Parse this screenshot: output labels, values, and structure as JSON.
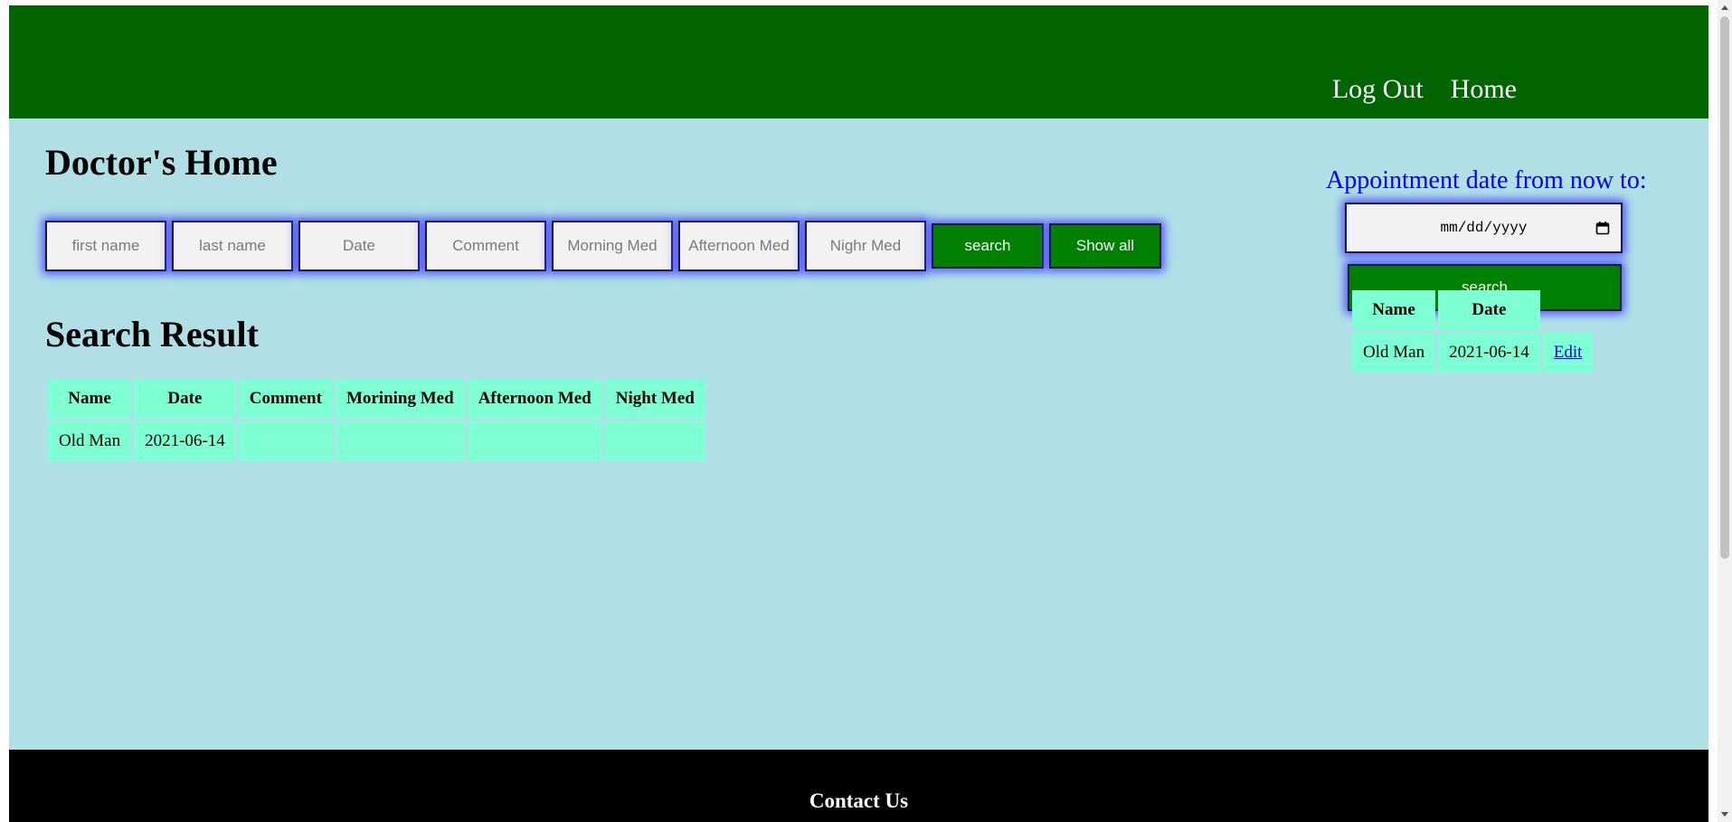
{
  "nav": {
    "logout_label": "Log Out",
    "home_label": "Home"
  },
  "page_title": "Doctor's Home",
  "search_form": {
    "first_name_placeholder": "first name",
    "last_name_placeholder": "last name",
    "date_placeholder": "Date",
    "comment_placeholder": "Comment",
    "morning_med_placeholder": "Morning Med",
    "afternoon_med_placeholder": "Afternoon Med",
    "night_med_placeholder": "Nighr Med",
    "search_label": "search",
    "show_all_label": "Show all"
  },
  "search_result": {
    "title": "Search Result",
    "headers": [
      "Name",
      "Date",
      "Comment",
      "Morining Med",
      "Afternoon Med",
      "Night Med"
    ],
    "rows": [
      [
        "Old Man",
        "2021-06-14",
        "",
        "",
        "",
        ""
      ]
    ]
  },
  "appointments": {
    "label": "Appointment date from now to:",
    "date_placeholder": "mm/dd/yyyy",
    "search_label": "search",
    "headers": [
      "Name",
      "Date"
    ],
    "rows": [
      {
        "name": "Old Man",
        "date": "2021-06-14",
        "action": "Edit"
      }
    ]
  },
  "footer": {
    "contact_label": "Contact Us"
  },
  "colors": {
    "header_bg": "#006400",
    "page_bg": "#b0e0e6",
    "button_bg": "#008000",
    "table_cell_bg": "#7fffd4",
    "footer_bg": "#000000",
    "appt_label": "#0000ff"
  }
}
